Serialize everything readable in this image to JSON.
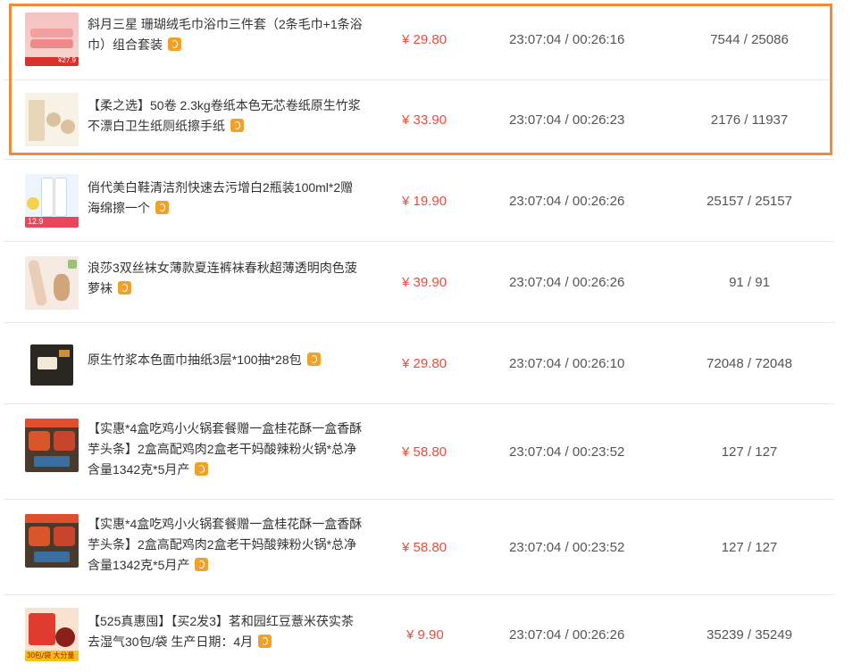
{
  "rows": [
    {
      "title": "斜月三星 珊瑚绒毛巾浴巾三件套（2条毛巾+1条浴巾）组合套装",
      "price": "¥ 29.80",
      "time": "23:07:04 / 00:26:16",
      "stock": "7544 / 25086",
      "thumb_label": "¥27.9"
    },
    {
      "title": "【柔之选】50卷 2.3kg卷纸本色无芯卷纸原生竹浆不漂白卫生纸厕纸擦手纸",
      "price": "¥ 33.90",
      "time": "23:07:04 / 00:26:23",
      "stock": "2176 / 11937",
      "thumb_label": ""
    },
    {
      "title": "俏代美白鞋清洁剂快速去污增白2瓶装100ml*2赠海绵擦一个",
      "price": "¥ 19.90",
      "time": "23:07:04 / 00:26:26",
      "stock": "25157 / 25157",
      "thumb_label": "12.9"
    },
    {
      "title": "浪莎3双丝袜女薄款夏连裤袜春秋超薄透明肉色菠萝袜",
      "price": "¥ 39.90",
      "time": "23:07:04 / 00:26:26",
      "stock": "91 / 91",
      "thumb_label": ""
    },
    {
      "title": "原生竹浆本色面巾抽纸3层*100抽*28包",
      "price": "¥ 29.80",
      "time": "23:07:04 / 00:26:10",
      "stock": "72048 / 72048",
      "thumb_label": ""
    },
    {
      "title": "【实惠*4盒吃鸡小火锅套餐赠一盒桂花酥一盒香酥芋头条】2盒高配鸡肉2盒老干妈酸辣粉火锅*总净含量1342克*5月产",
      "price": "¥ 58.80",
      "time": "23:07:04 / 00:23:52",
      "stock": "127 / 127",
      "thumb_label": ""
    },
    {
      "title": "【实惠*4盒吃鸡小火锅套餐赠一盒桂花酥一盒香酥芋头条】2盒高配鸡肉2盒老干妈酸辣粉火锅*总净含量1342克*5月产",
      "price": "¥ 58.80",
      "time": "23:07:04 / 00:23:52",
      "stock": "127 / 127",
      "thumb_label": ""
    },
    {
      "title": "【525真惠囤】【买2发3】茗和园红豆薏米茯实茶去湿气30包/袋 生产日期：4月",
      "price": "¥ 9.90",
      "time": "23:07:04 / 00:26:26",
      "stock": "35239 / 35249",
      "thumb_label": "30包/袋 大分量"
    }
  ]
}
